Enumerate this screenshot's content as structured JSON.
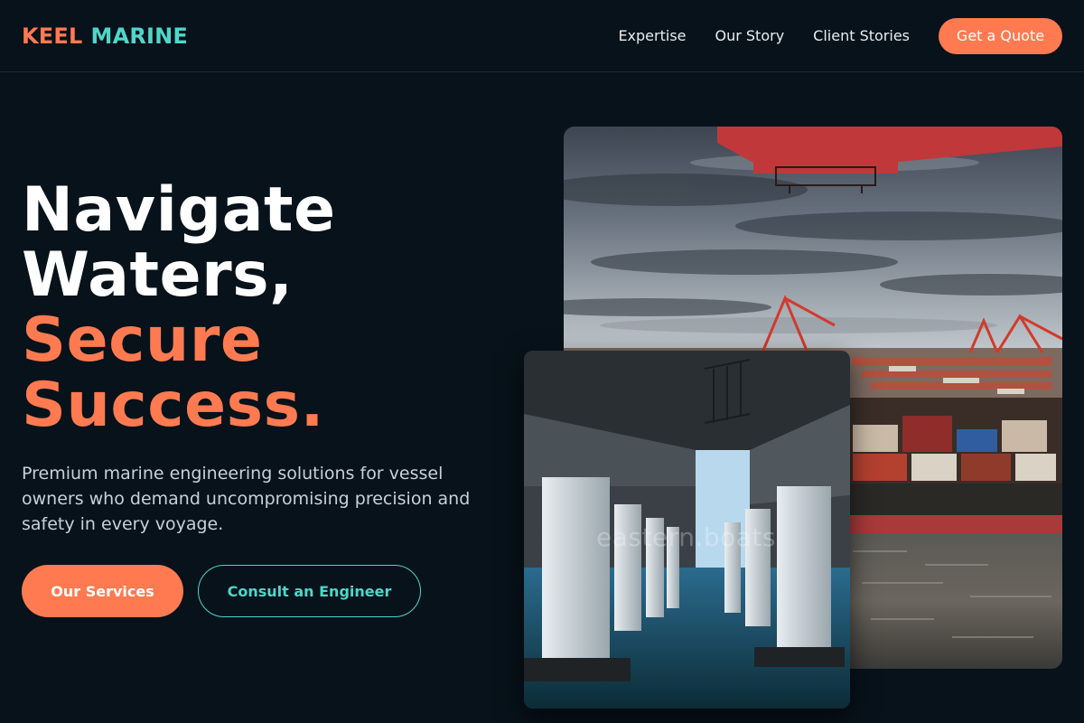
{
  "header": {
    "logo_part1": "KEEL",
    "logo_part2": "MARINE",
    "nav": [
      {
        "label": "Expertise"
      },
      {
        "label": "Our Story"
      },
      {
        "label": "Client Stories"
      }
    ],
    "cta_label": "Get a Quote"
  },
  "hero": {
    "title_line1": "Navigate",
    "title_line2": "Waters,",
    "title_line3": "Secure",
    "title_line4": "Success.",
    "subtitle": "Premium marine engineering solutions for vessel owners who demand uncompromising precision and safety in every voyage.",
    "primary_button": "Our Services",
    "secondary_button": "Consult an Engineer"
  },
  "images": {
    "watermark": "eastern.boats"
  },
  "colors": {
    "background": "#07121a",
    "accent_orange": "#ff7a50",
    "accent_teal": "#4fd6c9"
  }
}
